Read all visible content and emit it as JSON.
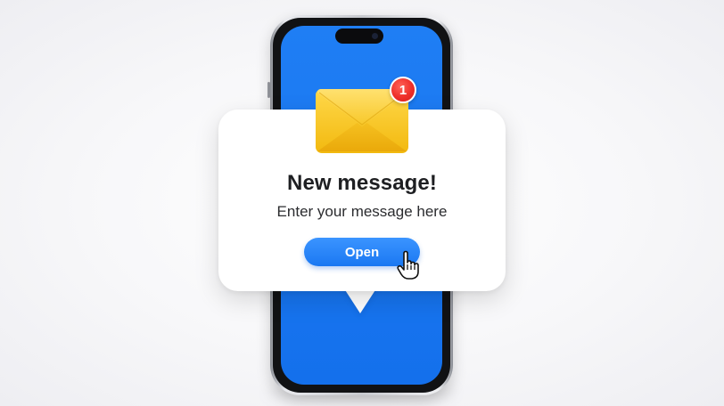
{
  "notification": {
    "badge_count": "1",
    "title": "New message!",
    "subtitle": "Enter your message here",
    "button_label": "Open"
  },
  "icons": {
    "envelope": "envelope-icon",
    "cursor": "hand-pointer-icon"
  },
  "colors": {
    "screen": "#1876f0",
    "button": "#1a78f2",
    "badge": "#ee2f2a",
    "envelope": "#f5c21b"
  }
}
